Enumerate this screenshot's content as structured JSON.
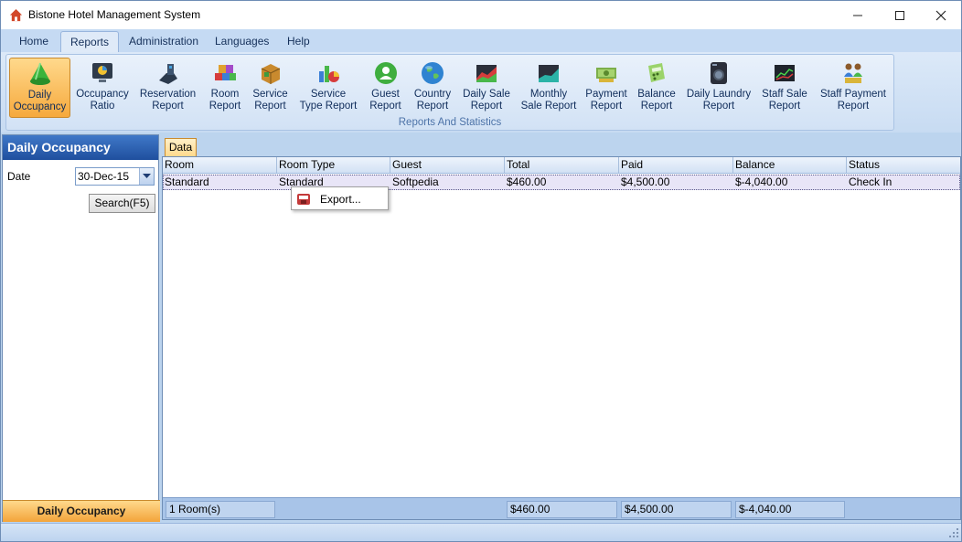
{
  "window": {
    "title": "Bistone Hotel Management System"
  },
  "menu_tabs": [
    {
      "label": "Home"
    },
    {
      "label": "Reports"
    },
    {
      "label": "Administration"
    },
    {
      "label": "Languages"
    },
    {
      "label": "Help"
    }
  ],
  "active_tab": "Reports",
  "ribbon": {
    "group_label": "Reports And Statistics",
    "buttons": [
      {
        "line1": "Daily",
        "line2": "Occupancy",
        "icon": "cone-icon",
        "active": true
      },
      {
        "line1": "Occupancy",
        "line2": "Ratio",
        "icon": "monitor-pie-icon"
      },
      {
        "line1": "Reservation",
        "line2": "Report",
        "icon": "blocks-icon"
      },
      {
        "line1": "Room",
        "line2": "Report",
        "icon": "cubes-icon"
      },
      {
        "line1": "Service",
        "line2": "Report",
        "icon": "box-icon"
      },
      {
        "line1": "Service",
        "line2": "Type Report",
        "icon": "bars-pie-icon"
      },
      {
        "line1": "Guest",
        "line2": "Report",
        "icon": "user-green-icon"
      },
      {
        "line1": "Country",
        "line2": "Report",
        "icon": "globe-icon"
      },
      {
        "line1": "Daily Sale",
        "line2": "Report",
        "icon": "area-chart-icon"
      },
      {
        "line1": "Monthly",
        "line2": "Sale Report",
        "icon": "area-chart-teal-icon"
      },
      {
        "line1": "Payment",
        "line2": "Report",
        "icon": "money-icon"
      },
      {
        "line1": "Balance",
        "line2": "Report",
        "icon": "calculator-icon"
      },
      {
        "line1": "Daily Laundry",
        "line2": "Report",
        "icon": "washer-icon"
      },
      {
        "line1": "Staff Sale",
        "line2": "Report",
        "icon": "stock-chart-icon"
      },
      {
        "line1": "Staff Payment",
        "line2": "Report",
        "icon": "people-money-icon"
      }
    ]
  },
  "left_panel": {
    "title": "Daily Occupancy",
    "date_label": "Date",
    "date_value": "30-Dec-15",
    "search_button": "Search(F5)",
    "footer": "Daily Occupancy"
  },
  "data_tab": "Data",
  "table": {
    "columns": [
      "Room",
      "Room Type",
      "Guest",
      "Total",
      "Paid",
      "Balance",
      "Status"
    ],
    "rows": [
      [
        "Standard",
        "Standard",
        "Softpedia",
        "$460.00",
        "$4,500.00",
        "$-4,040.00",
        "Check In"
      ]
    ],
    "footer": {
      "room_count": "1 Room(s)",
      "total": "$460.00",
      "paid": "$4,500.00",
      "balance": "$-4,040.00"
    }
  },
  "context_menu": {
    "items": [
      {
        "label": "Export...",
        "icon": "export-icon"
      }
    ]
  },
  "colors": {
    "accent_orange": "#f6a93d",
    "header_blue": "#1f4f9e",
    "ribbon_text": "#0f2c5a"
  }
}
